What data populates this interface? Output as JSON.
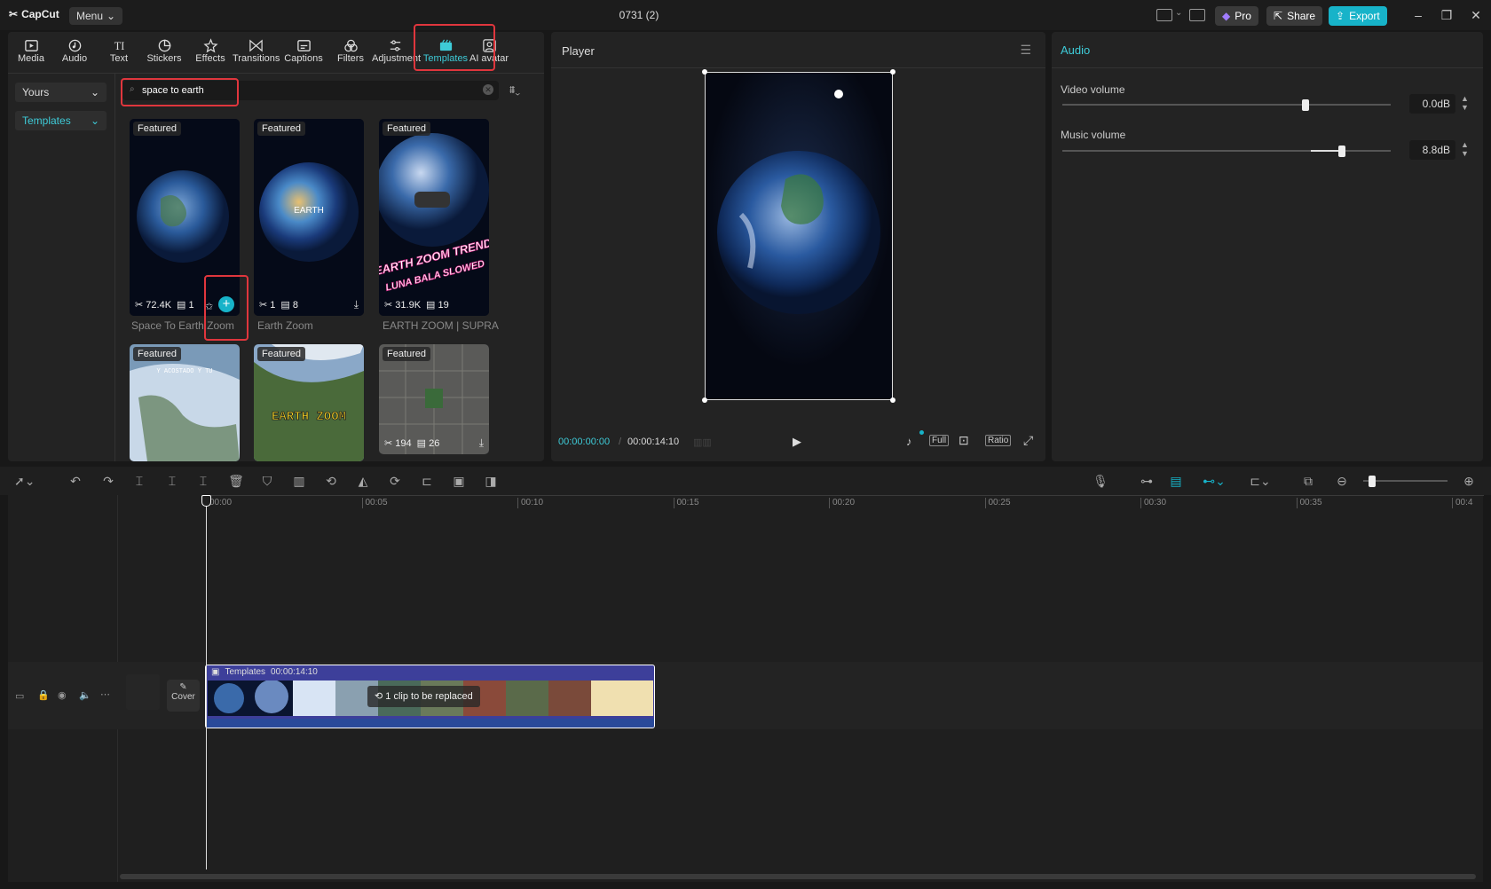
{
  "app": {
    "logo_text": "CapCut",
    "menu_label": "Menu",
    "project_title": "0731 (2)"
  },
  "titlebar": {
    "pro_label": "Pro",
    "share_label": "Share",
    "export_label": "Export",
    "accent": "#17b3c9"
  },
  "tabs": [
    {
      "label": "Media",
      "icon": "media-icon"
    },
    {
      "label": "Audio",
      "icon": "audio-icon"
    },
    {
      "label": "Text",
      "icon": "text-icon"
    },
    {
      "label": "Stickers",
      "icon": "stickers-icon"
    },
    {
      "label": "Effects",
      "icon": "effects-icon"
    },
    {
      "label": "Transitions",
      "icon": "transitions-icon"
    },
    {
      "label": "Captions",
      "icon": "captions-icon"
    },
    {
      "label": "Filters",
      "icon": "filters-icon"
    },
    {
      "label": "Adjustment",
      "icon": "adjustment-icon"
    },
    {
      "label": "Templates",
      "icon": "templates-icon",
      "active": true
    },
    {
      "label": "AI avatar",
      "icon": "ai-avatar-icon"
    }
  ],
  "sidebar": {
    "yours_label": "Yours",
    "templates_label": "Templates"
  },
  "search": {
    "value": "space to earth"
  },
  "templates": [
    {
      "badge": "Featured",
      "uses": "72.4K",
      "clips": "1",
      "title": "Space To Earth Zoom"
    },
    {
      "badge": "Featured",
      "uses": "1",
      "clips": "8",
      "title": "Earth Zoom"
    },
    {
      "badge": "Featured",
      "uses": "31.9K",
      "clips": "19",
      "title": "EARTH ZOOM | SUPRA"
    },
    {
      "badge": "Featured"
    },
    {
      "badge": "Featured"
    },
    {
      "badge": "Featured",
      "uses": "194",
      "clips": "26"
    }
  ],
  "template_overlays": {
    "card2_text": "EARTH",
    "card3_text_1": "EARTH ZOOM TREND",
    "card3_text_2": "LUNA BALA SLOWED",
    "card4_text": "Y ACOSTADO Y TU",
    "card5_text": "EARTH ZOOM"
  },
  "player": {
    "title": "Player",
    "time_current": "00:00:00:00",
    "time_total": "00:00:14:10",
    "full_label": "Full",
    "ratio_label": "Ratio"
  },
  "audio_panel": {
    "title": "Audio",
    "video_volume_label": "Video volume",
    "video_volume_value": "0.0dB",
    "video_volume_level": 0.74,
    "music_volume_label": "Music volume",
    "music_volume_value": "8.8dB",
    "music_volume_level": 0.85
  },
  "timeline": {
    "ruler": [
      "00:00",
      "00:05",
      "00:10",
      "00:15",
      "00:20",
      "00:25",
      "00:30",
      "00:35",
      "00:4"
    ],
    "clip_label": "Templates",
    "clip_duration": "00:00:14:10",
    "clip_replace": "1 clip to be replaced",
    "cover_label": "Cover"
  }
}
